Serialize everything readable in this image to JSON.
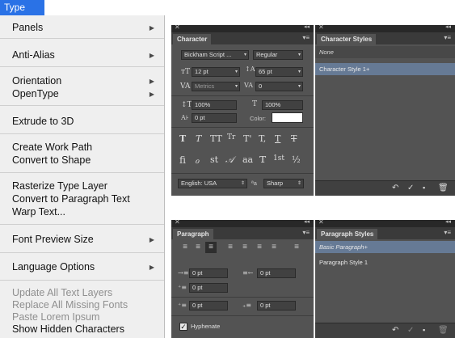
{
  "menu": {
    "title": "Type",
    "items": [
      {
        "label": "Panels",
        "submenu": true
      },
      {
        "label": "Anti-Alias",
        "submenu": true
      },
      {
        "label": "Orientation",
        "submenu": true
      },
      {
        "label": "OpenType",
        "submenu": true
      },
      {
        "label": "Extrude to 3D",
        "submenu": false
      },
      {
        "label": "Create Work Path",
        "submenu": false
      },
      {
        "label": "Convert to Shape",
        "submenu": false
      },
      {
        "label": "Rasterize Type Layer",
        "submenu": false
      },
      {
        "label": "Convert to Paragraph Text",
        "submenu": false
      },
      {
        "label": "Warp Text...",
        "submenu": false
      },
      {
        "label": "Font Preview Size",
        "submenu": true
      },
      {
        "label": "Language Options",
        "submenu": true
      },
      {
        "label": "Update All Text Layers",
        "submenu": false,
        "disabled": true
      },
      {
        "label": "Replace All Missing Fonts",
        "submenu": false,
        "disabled": true
      },
      {
        "label": "Paste Lorem Ipsum",
        "submenu": false,
        "disabled": true
      },
      {
        "label": "Show Hidden Characters",
        "submenu": false
      }
    ]
  },
  "character": {
    "tab": "Character",
    "font_family": "Bickham Script ...",
    "font_style": "Regular",
    "size": "12 pt",
    "leading": "65 pt",
    "kerning": "Metrics",
    "tracking": "0",
    "vscale": "100%",
    "hscale": "100%",
    "baseline": "0 pt",
    "color_label": "Color:",
    "language": "English: USA",
    "aa_glyph": "ªa",
    "antialias": "Sharp",
    "color_swatch": "#ffffff"
  },
  "char_styles": {
    "tab": "Character Styles",
    "items": [
      "None",
      "Character Style 1+"
    ]
  },
  "paragraph": {
    "tab": "Paragraph",
    "indent_left": "0 pt",
    "indent_right": "0 pt",
    "indent_first": "0 pt",
    "space_before": "0 pt",
    "space_after": "0 pt",
    "hyphenate_label": "Hyphenate",
    "hyphenate": true
  },
  "para_styles": {
    "tab": "Paragraph Styles",
    "items": [
      "Basic Paragraph+",
      "Paragraph Style 1"
    ]
  }
}
